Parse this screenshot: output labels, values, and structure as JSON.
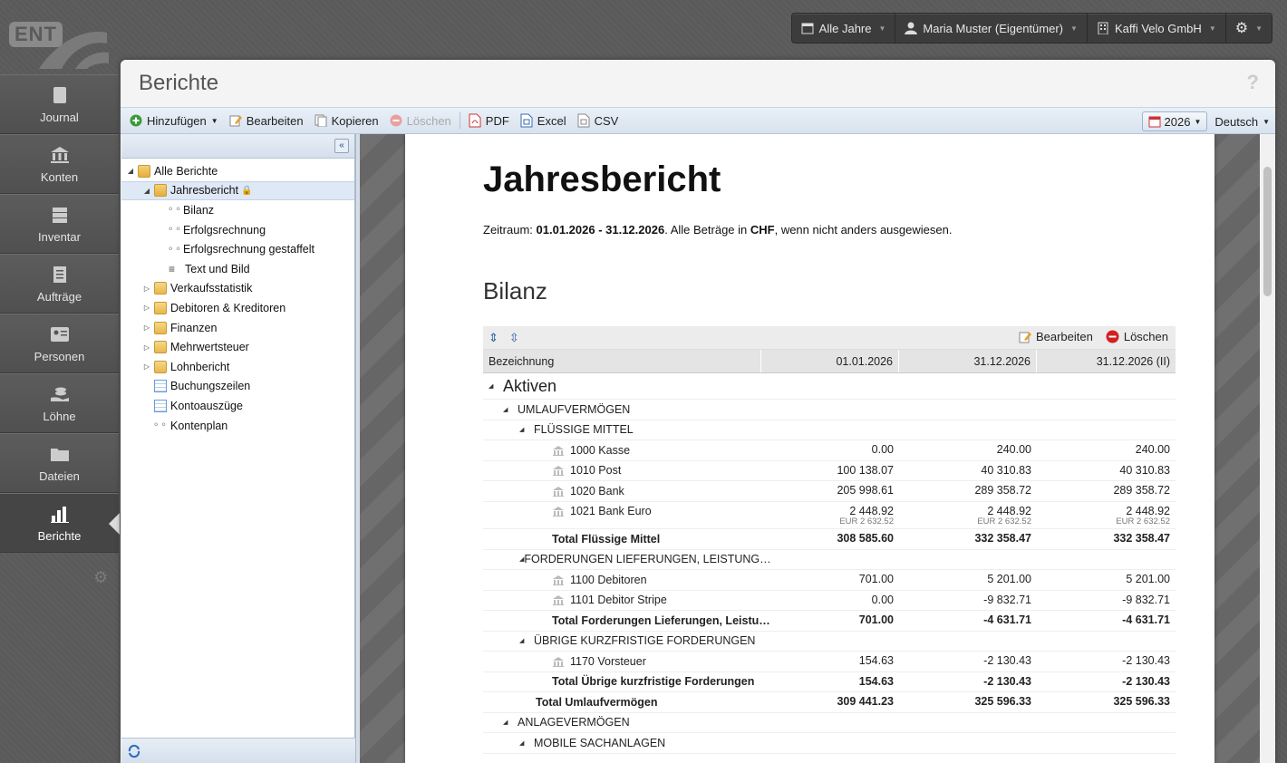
{
  "logo": {
    "text": "ENT"
  },
  "topbar": {
    "year": "Alle Jahre",
    "user": "Maria Muster (Eigentümer)",
    "company": "Kaffi Velo GmbH"
  },
  "sidebar": {
    "items": [
      {
        "label": "Journal"
      },
      {
        "label": "Konten"
      },
      {
        "label": "Inventar"
      },
      {
        "label": "Aufträge"
      },
      {
        "label": "Personen"
      },
      {
        "label": "Löhne"
      },
      {
        "label": "Dateien"
      },
      {
        "label": "Berichte"
      }
    ]
  },
  "panel": {
    "title": "Berichte",
    "help": "?"
  },
  "toolbar": {
    "add": "Hinzufügen",
    "edit": "Bearbeiten",
    "copy": "Kopieren",
    "delete": "Löschen",
    "pdf": "PDF",
    "excel": "Excel",
    "csv": "CSV",
    "year": "2026",
    "language": "Deutsch"
  },
  "tree": {
    "collapse": "«",
    "nodes": {
      "all": "Alle Berichte",
      "jahres": "Jahresbericht",
      "bilanz": "Bilanz",
      "erfolg": "Erfolgsrechnung",
      "erfolgst": "Erfolgsrechnung gestaffelt",
      "textbild": "Text und Bild",
      "verkauf": "Verkaufsstatistik",
      "debkred": "Debitoren & Kreditoren",
      "finanzen": "Finanzen",
      "mwst": "Mehrwertsteuer",
      "lohn": "Lohnbericht",
      "buchung": "Buchungszeilen",
      "konto": "Kontoauszüge",
      "kontenplan": "Kontenplan"
    }
  },
  "report": {
    "title": "Jahresbericht",
    "period_prefix": "Zeitraum: ",
    "period": "01.01.2026 - 31.12.2026",
    "period_mid": ". Alle Beträge in ",
    "currency": "CHF",
    "period_suffix": ", wenn nicht anders ausgewiesen.",
    "section": "Bilanz"
  },
  "table": {
    "edit": "Bearbeiten",
    "delete": "Löschen",
    "headers": [
      "Bezeichnung",
      "01.01.2026",
      "31.12.2026",
      "31.12.2026 (II)"
    ],
    "rows": [
      {
        "t": "big",
        "label": "Aktiven",
        "indent": 0,
        "v": [
          "",
          "",
          ""
        ]
      },
      {
        "t": "grp",
        "label": "UMLAUFVERMÖGEN",
        "indent": 1,
        "v": [
          "",
          "",
          ""
        ]
      },
      {
        "t": "grp",
        "label": "FLÜSSIGE MITTEL",
        "indent": 2,
        "v": [
          "",
          "",
          ""
        ]
      },
      {
        "t": "acc",
        "label": "1000 Kasse",
        "indent": 3,
        "v": [
          "0.00",
          "240.00",
          "240.00"
        ]
      },
      {
        "t": "acc",
        "label": "1010 Post",
        "indent": 3,
        "v": [
          "100 138.07",
          "40 310.83",
          "40 310.83"
        ]
      },
      {
        "t": "acc",
        "label": "1020 Bank",
        "indent": 3,
        "v": [
          "205 998.61",
          "289 358.72",
          "289 358.72"
        ]
      },
      {
        "t": "acc",
        "label": "1021 Bank Euro",
        "indent": 3,
        "v": [
          "2 448.92",
          "2 448.92",
          "2 448.92"
        ],
        "s": [
          "EUR 2 632.52",
          "EUR 2 632.52",
          "EUR 2 632.52"
        ]
      },
      {
        "t": "tot",
        "label": "Total Flüssige Mittel",
        "indent": 3,
        "v": [
          "308 585.60",
          "332 358.47",
          "332 358.47"
        ]
      },
      {
        "t": "grp",
        "label": "FORDERUNGEN LIEFERUNGEN, LEISTUNG…",
        "indent": 2,
        "v": [
          "",
          "",
          ""
        ]
      },
      {
        "t": "acc",
        "label": "1100 Debitoren",
        "indent": 3,
        "v": [
          "701.00",
          "5 201.00",
          "5 201.00"
        ]
      },
      {
        "t": "acc",
        "label": "1101 Debitor Stripe",
        "indent": 3,
        "v": [
          "0.00",
          "-9 832.71",
          "-9 832.71"
        ]
      },
      {
        "t": "tot",
        "label": "Total Forderungen Lieferungen, Leistu…",
        "indent": 3,
        "v": [
          "701.00",
          "-4 631.71",
          "-4 631.71"
        ]
      },
      {
        "t": "grp",
        "label": "ÜBRIGE KURZFRISTIGE FORDERUNGEN",
        "indent": 2,
        "v": [
          "",
          "",
          ""
        ]
      },
      {
        "t": "acc",
        "label": "1170 Vorsteuer",
        "indent": 3,
        "v": [
          "154.63",
          "-2 130.43",
          "-2 130.43"
        ]
      },
      {
        "t": "tot",
        "label": "Total Übrige kurzfristige Forderungen",
        "indent": 3,
        "v": [
          "154.63",
          "-2 130.43",
          "-2 130.43"
        ]
      },
      {
        "t": "tot",
        "label": "Total Umlaufvermögen",
        "indent": 2,
        "v": [
          "309 441.23",
          "325 596.33",
          "325 596.33"
        ]
      },
      {
        "t": "grp",
        "label": "ANLAGEVERMÖGEN",
        "indent": 1,
        "v": [
          "",
          "",
          ""
        ]
      },
      {
        "t": "grp",
        "label": "MOBILE SACHANLAGEN",
        "indent": 2,
        "v": [
          "",
          "",
          ""
        ]
      }
    ]
  },
  "colors": {
    "accent": "#dfe8f5",
    "toolbar": "#d8e2ee",
    "sidebar": "#555555"
  }
}
